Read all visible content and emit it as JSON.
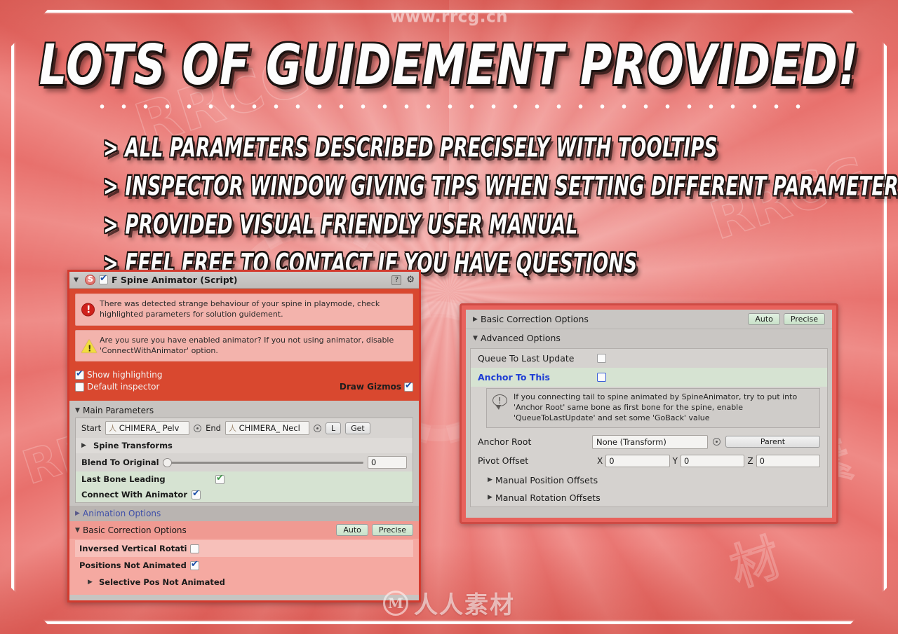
{
  "watermarks": {
    "top": "www.rrcg.cn",
    "bottom_logo": "M",
    "bottom_text": "人人素材",
    "ghosts": [
      "RRCG",
      "人人素材",
      "RRCG",
      "人人素材",
      "RRCG"
    ]
  },
  "poster": {
    "headline": "LOTS OF GUIDEMENT PROVIDED!",
    "bullets": [
      "> ALL PARAMETERS DESCRIBED PRECISELY WITH TOOLTIPS",
      "> INSPECTOR WINDOW GIVING TIPS WHEN SETTING DIFFERENT PARAMETERS",
      "> PROVIDED VISUAL FRIENDLY USER MANUAL",
      "> FEEL FREE TO CONTACT IF YOU HAVE QUESTIONS"
    ],
    "colors": {
      "background_red": "#c4392f",
      "ray_light": "#ef8a86",
      "ray_dark": "#e8706c",
      "frame_white": "#ffffff",
      "headline_fill": "#fdfdfd",
      "headline_outline": "#1a1210"
    }
  },
  "left_panel": {
    "header": {
      "foldout": "▼",
      "script_icon": "script-icon",
      "enabled_checkbox": true,
      "title": "F Spine Animator (Script)",
      "help_icon": "?",
      "gear_icon": "⚙"
    },
    "messages": [
      {
        "type": "error",
        "text": "There was detected strange behaviour of your spine in playmode, check highlighted parameters for solution guidement."
      },
      {
        "type": "warning",
        "text": "Are you sure you have enabled animator? If you not using animator, disable 'ConnectWithAnimator' option."
      }
    ],
    "toggles": [
      {
        "label": "Show highlighting",
        "checked": true
      },
      {
        "label": "Default inspector",
        "checked": false
      }
    ],
    "draw_gizmos": {
      "label": "Draw Gizmos",
      "checked": true
    },
    "main_parameters": {
      "foldout": "▼",
      "title": "Main Parameters",
      "start_label": "Start",
      "start_value": "CHIMERA_ Pelv",
      "end_label": "End",
      "end_value": "CHIMERA_ Necl",
      "l_button": "L",
      "get_button": "Get",
      "spine_transforms": "Spine Transforms",
      "blend_label": "Blend To Original",
      "blend_value": "0",
      "last_bone_leading": {
        "label": "Last Bone Leading",
        "checked": true
      },
      "connect_with_animator": {
        "label": "Connect With Animator",
        "checked": true
      }
    },
    "animation_options": {
      "foldout": "▶",
      "title": "Animation Options"
    },
    "basic_correction": {
      "foldout": "▼",
      "title": "Basic Correction Options",
      "auto_button": "Auto",
      "precise_button": "Precise",
      "rows": [
        {
          "label": "Inversed Vertical Rotati",
          "checked": false,
          "type": "toggle"
        },
        {
          "label": "Positions Not Animated",
          "checked": true,
          "type": "toggle"
        },
        {
          "label": "Selective Pos Not Animated",
          "type": "foldout",
          "foldout": "▶"
        }
      ]
    }
  },
  "right_panel": {
    "basic_correction": {
      "foldout": "▶",
      "title": "Basic Correction Options",
      "auto_button": "Auto",
      "precise_button": "Precise"
    },
    "advanced_options": {
      "foldout": "▼",
      "title": "Advanced Options",
      "queue_to_last_update": {
        "label": "Queue To Last Update",
        "checked": false
      },
      "anchor_to_this": {
        "label": "Anchor To This",
        "checked": false,
        "color": "#1f3fd4"
      },
      "tip": "If you connecting tail to spine animated by SpineAnimator, try to put into 'Anchor Root' same bone as first bone for the spine, enable 'QueueToLastUpdate' and set some 'GoBack' value",
      "anchor_root": {
        "label": "Anchor Root",
        "value": "None (Transform)",
        "parent_button": "Parent"
      },
      "pivot_offset": {
        "label": "Pivot Offset",
        "x_label": "X",
        "x": "0",
        "y_label": "Y",
        "y": "0",
        "z_label": "Z",
        "z": "0"
      },
      "manual_position_offsets": {
        "foldout": "▶",
        "title": "Manual Position Offsets"
      },
      "manual_rotation_offsets": {
        "foldout": "▶",
        "title": "Manual Rotation Offsets"
      }
    }
  }
}
